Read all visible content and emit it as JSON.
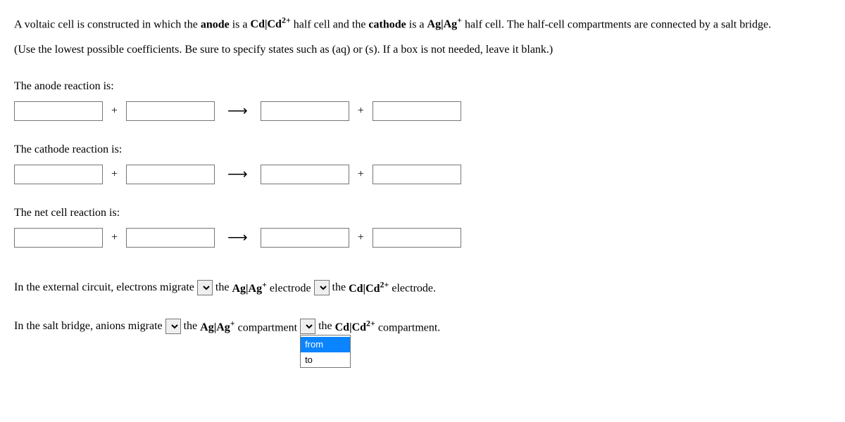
{
  "intro": {
    "part1": "A voltaic cell is constructed in which the ",
    "anode_bold": "anode",
    "part2": " is a ",
    "anode_cell_prefix": "Cd|Cd",
    "anode_cell_sup": "2+",
    "part3": " half cell and the ",
    "cathode_bold": "cathode",
    "part4": " is a ",
    "cathode_cell_prefix": "Ag|Ag",
    "cathode_cell_sup": "+",
    "part5": " half cell. The half-cell compartments are connected by a salt bridge."
  },
  "instructions": "(Use the lowest possible coefficients. Be sure to specify states such as (aq) or (s). If a box is not needed, leave it blank.)",
  "labels": {
    "anode": "The anode reaction is:",
    "cathode": "The cathode reaction is:",
    "net": "The net cell reaction is:"
  },
  "symbols": {
    "plus": "+",
    "arrow": "⟶"
  },
  "sentence1": {
    "part1": "In the external circuit, electrons migrate ",
    "part2": " the ",
    "elec1_prefix": "Ag|Ag",
    "elec1_sup": "+",
    "elec1_suffix": " electrode ",
    "part3": " the ",
    "elec2_prefix": "Cd|Cd",
    "elec2_sup": "2+",
    "elec2_suffix": " electrode."
  },
  "sentence2": {
    "part1": "In the salt bridge, anions migrate ",
    "part2": " the ",
    "comp1_prefix": "Ag|Ag",
    "comp1_sup": "+",
    "comp1_suffix": " compartment ",
    "part3": " the ",
    "comp2_prefix": "Cd|Cd",
    "comp2_sup": "2+",
    "comp2_suffix": " compartment."
  },
  "dropdown": {
    "blank": "",
    "from": "from",
    "to": "to"
  }
}
